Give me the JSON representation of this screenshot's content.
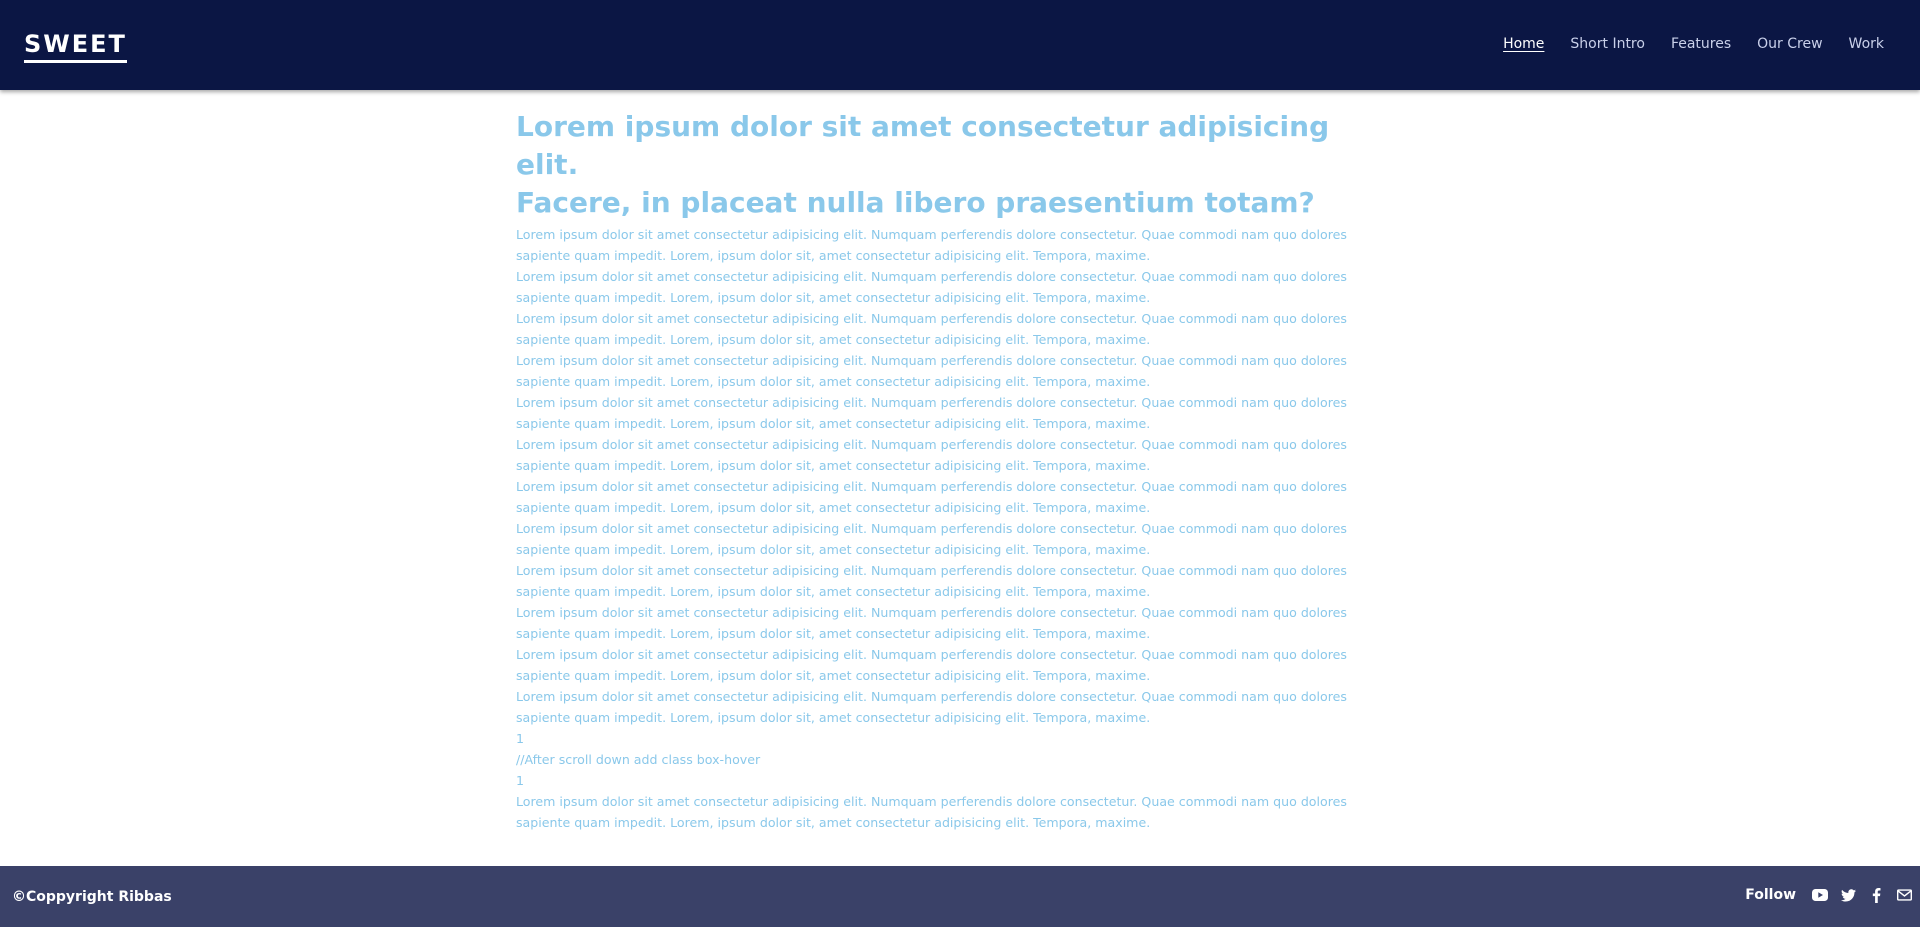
{
  "colors": {
    "header_bg": "#0b1644",
    "footer_bg": "#3a4168",
    "text": "#8ac8ea",
    "nav_active": "#ffffff",
    "nav_inactive": "#c9d0ea"
  },
  "header": {
    "brand": "SWEET",
    "nav": [
      {
        "label": "Home",
        "active": true
      },
      {
        "label": "Short Intro",
        "active": false
      },
      {
        "label": "Features",
        "active": false
      },
      {
        "label": "Our Crew",
        "active": false
      },
      {
        "label": "Work",
        "active": false
      }
    ]
  },
  "main": {
    "headline_line1": "Lorem ipsum dolor sit amet consectetur adipisicing elit.",
    "headline_line2": "Facere, in placeat nulla libero praesentium totam?",
    "paragraphs": [
      "Lorem ipsum dolor sit amet consectetur adipisicing elit. Numquam perferendis dolore consectetur. Quae commodi nam quo dolores sapiente quam impedit. Lorem, ipsum dolor sit, amet consectetur adipisicing elit. Tempora, maxime.",
      "Lorem ipsum dolor sit amet consectetur adipisicing elit. Numquam perferendis dolore consectetur. Quae commodi nam quo dolores sapiente quam impedit. Lorem, ipsum dolor sit, amet consectetur adipisicing elit. Tempora, maxime.",
      "Lorem ipsum dolor sit amet consectetur adipisicing elit. Numquam perferendis dolore consectetur. Quae commodi nam quo dolores sapiente quam impedit. Lorem, ipsum dolor sit, amet consectetur adipisicing elit. Tempora, maxime.",
      "Lorem ipsum dolor sit amet consectetur adipisicing elit. Numquam perferendis dolore consectetur. Quae commodi nam quo dolores sapiente quam impedit. Lorem, ipsum dolor sit, amet consectetur adipisicing elit. Tempora, maxime.",
      "Lorem ipsum dolor sit amet consectetur adipisicing elit. Numquam perferendis dolore consectetur. Quae commodi nam quo dolores sapiente quam impedit. Lorem, ipsum dolor sit, amet consectetur adipisicing elit. Tempora, maxime.",
      "Lorem ipsum dolor sit amet consectetur adipisicing elit. Numquam perferendis dolore consectetur. Quae commodi nam quo dolores sapiente quam impedit. Lorem, ipsum dolor sit, amet consectetur adipisicing elit. Tempora, maxime.",
      "Lorem ipsum dolor sit amet consectetur adipisicing elit. Numquam perferendis dolore consectetur. Quae commodi nam quo dolores sapiente quam impedit. Lorem, ipsum dolor sit, amet consectetur adipisicing elit. Tempora, maxime.",
      "Lorem ipsum dolor sit amet consectetur adipisicing elit. Numquam perferendis dolore consectetur. Quae commodi nam quo dolores sapiente quam impedit. Lorem, ipsum dolor sit, amet consectetur adipisicing elit. Tempora, maxime.",
      "Lorem ipsum dolor sit amet consectetur adipisicing elit. Numquam perferendis dolore consectetur. Quae commodi nam quo dolores sapiente quam impedit. Lorem, ipsum dolor sit, amet consectetur adipisicing elit. Tempora, maxime.",
      "Lorem ipsum dolor sit amet consectetur adipisicing elit. Numquam perferendis dolore consectetur. Quae commodi nam quo dolores sapiente quam impedit. Lorem, ipsum dolor sit, amet consectetur adipisicing elit. Tempora, maxime.",
      "Lorem ipsum dolor sit amet consectetur adipisicing elit. Numquam perferendis dolore consectetur. Quae commodi nam quo dolores sapiente quam impedit. Lorem, ipsum dolor sit, amet consectetur adipisicing elit. Tempora, maxime.",
      "Lorem ipsum dolor sit amet consectetur adipisicing elit. Numquam perferendis dolore consectetur. Quae commodi nam quo dolores sapiente quam impedit. Lorem, ipsum dolor sit, amet consectetur adipisicing elit. Tempora, maxime."
    ],
    "code_lines": [
      "1",
      "//After scroll down add class box-hover",
      "1"
    ],
    "last_paragraph": "Lorem ipsum dolor sit amet consectetur adipisicing elit. Numquam perferendis dolore consectetur. Quae commodi nam quo dolores sapiente quam impedit. Lorem, ipsum dolor sit, amet consectetur adipisicing elit. Tempora, maxime."
  },
  "footer": {
    "copyright": "©Coppyright Ribbas",
    "follow_label": "Follow",
    "social_icons": [
      "youtube-icon",
      "twitter-icon",
      "facebook-icon",
      "mail-icon"
    ]
  }
}
